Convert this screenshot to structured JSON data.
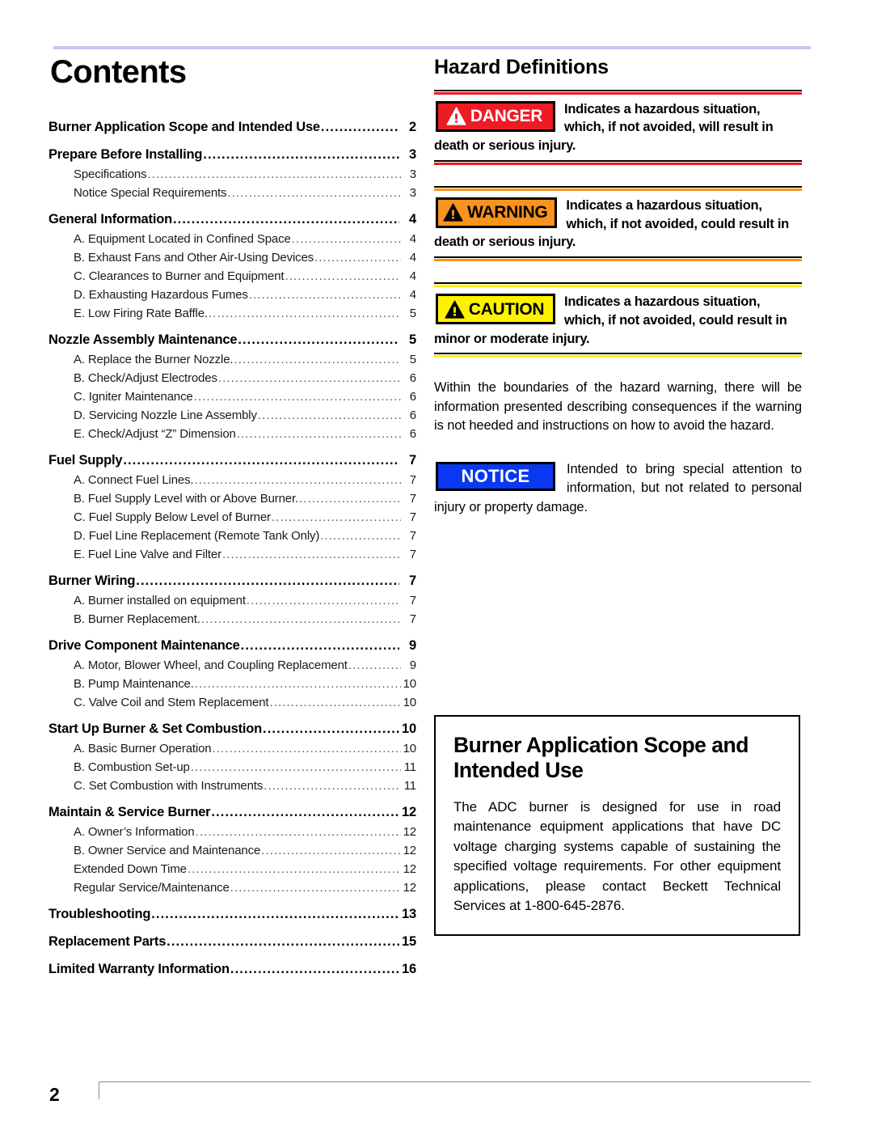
{
  "page": {
    "number": "2",
    "top_rule_color": "#c3c8f5"
  },
  "contents": {
    "title": "Contents",
    "groups": [
      {
        "heading": {
          "label": "Burner Application Scope and Intended Use",
          "page": "2"
        },
        "items": []
      },
      {
        "heading": {
          "label": "Prepare Before Installing",
          "page": "3"
        },
        "items": [
          {
            "label": "Specifications",
            "page": "3"
          },
          {
            "label": "Notice Special Requirements",
            "page": "3"
          }
        ]
      },
      {
        "heading": {
          "label": "General Information",
          "page": "4"
        },
        "items": [
          {
            "label": "A. Equipment Located in Confined Space",
            "page": "4"
          },
          {
            "label": "B. Exhaust Fans and Other Air-Using Devices",
            "page": "4"
          },
          {
            "label": "C. Clearances to Burner and Equipment",
            "page": "4"
          },
          {
            "label": "D. Exhausting Hazardous Fumes",
            "page": "4"
          },
          {
            "label": "E. Low Firing Rate Baffle.",
            "page": "5"
          }
        ]
      },
      {
        "heading": {
          "label": "Nozzle Assembly Maintenance",
          "page": "5"
        },
        "items": [
          {
            "label": "A. Replace the Burner Nozzle.",
            "page": "5"
          },
          {
            "label": "B. Check/Adjust Electrodes",
            "page": "6"
          },
          {
            "label": "C. Igniter Maintenance",
            "page": "6"
          },
          {
            "label": "D. Servicing Nozzle Line Assembly",
            "page": "6"
          },
          {
            "label": "E. Check/Adjust “Z” Dimension",
            "page": "6"
          }
        ]
      },
      {
        "heading": {
          "label": "Fuel Supply",
          "page": "7"
        },
        "items": [
          {
            "label": "A. Connect Fuel Lines.",
            "page": "7"
          },
          {
            "label": "B. Fuel Supply Level with or Above Burner.",
            "page": "7"
          },
          {
            "label": "C. Fuel Supply Below Level of Burner",
            "page": "7"
          },
          {
            "label": "D. Fuel Line Replacement (Remote Tank Only)",
            "page": "7"
          },
          {
            "label": "E.  Fuel Line Valve and Filter",
            "page": "7"
          }
        ]
      },
      {
        "heading": {
          "label": "Burner Wiring",
          "page": "7"
        },
        "items": [
          {
            "label": "A. Burner installed on equipment",
            "page": "7"
          },
          {
            "label": "B. Burner Replacement.",
            "page": "7"
          }
        ]
      },
      {
        "heading": {
          "label": "Drive Component Maintenance",
          "page": "9"
        },
        "items": [
          {
            "label": "A. Motor, Blower Wheel, and Coupling Replacement",
            "page": "9"
          },
          {
            "label": "B. Pump Maintenance.",
            "page": "10"
          },
          {
            "label": "C. Valve Coil and Stem Replacement",
            "page": "10"
          }
        ]
      },
      {
        "heading": {
          "label": "Start Up Burner & Set Combustion",
          "page": "10"
        },
        "items": [
          {
            "label": "A. Basic Burner Operation",
            "page": "10"
          },
          {
            "label": "B. Combustion Set-up",
            "page": "11"
          },
          {
            "label": "C. Set Combustion with Instruments",
            "page": "11"
          }
        ]
      },
      {
        "heading": {
          "label": "Maintain & Service Burner",
          "page": "12"
        },
        "items": [
          {
            "label": "A. Owner’s Information",
            "page": "12"
          },
          {
            "label": "B. Owner Service and Maintenance ",
            "page": "12"
          },
          {
            "label": "Extended Down Time",
            "page": "12"
          },
          {
            "label": "Regular Service/Maintenance",
            "page": "12"
          }
        ]
      },
      {
        "heading": {
          "label": "Troubleshooting",
          "page": "13"
        },
        "items": []
      },
      {
        "heading": {
          "label": "Replacement Parts",
          "page": "15"
        },
        "items": []
      },
      {
        "heading": {
          "label": "Limited Warranty Information",
          "page": "16"
        },
        "items": []
      }
    ]
  },
  "hazards": {
    "title": "Hazard Definitions",
    "danger": {
      "word": "DANGER",
      "text": "Indicates a hazardous situation, which, if not avoided, will result in death or serious injury.",
      "accent": "#ed1c24",
      "text_color": "#ffffff",
      "icon": "warning-triangle-icon"
    },
    "warning": {
      "word": "WARNING",
      "text": "Indicates a hazardous situation, which, if not avoided, could result in death or serious injury.",
      "accent": "#f7931e",
      "text_color": "#000000",
      "icon": "warning-triangle-icon"
    },
    "caution": {
      "word": "CAUTION",
      "text": "Indicates a hazardous situation, which, if not avoided, could result in minor or moderate injury.",
      "accent": "#fff200",
      "text_color": "#000000",
      "icon": "warning-triangle-icon"
    },
    "boundary_note": "Within the boundaries of the hazard warning, there will be information presented describing consequences if the warning is not heeded and instructions on how to avoid the hazard.",
    "notice": {
      "word": "NOTICE",
      "text": "Intended to bring special attention to information, but not related to personal injury or property damage.",
      "accent": "#0a38f0",
      "text_color": "#ffffff"
    }
  },
  "scope": {
    "title": "Burner Application Scope and Intended Use",
    "body": "The ADC burner is designed for use in road maintenance equipment applications that have DC voltage charging systems capable of sustaining the specified voltage requirements. For other equipment applications, please contact Beckett Technical Services at 1-800-645-2876."
  }
}
